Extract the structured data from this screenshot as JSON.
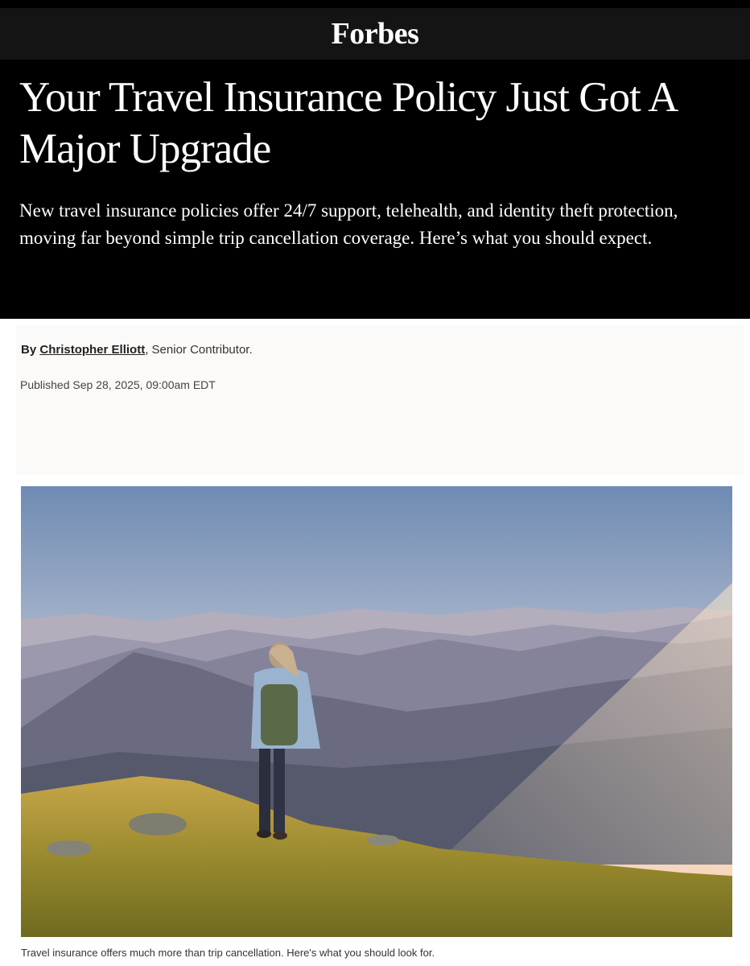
{
  "header": {
    "logo": "Forbes"
  },
  "article": {
    "headline": "Your Travel Insurance Policy Just Got A Major Upgrade",
    "dek": "New travel insurance policies offer 24/7 support, telehealth, and identity theft protection, moving far beyond simple trip cancellation coverage. Here’s what you should expect.",
    "byline_prefix": "By",
    "author": "Christopher Elliott",
    "author_suffix": ",",
    "author_role": "Senior Contributor.",
    "published": "Published Sep 28, 2025, 09:00am EDT",
    "image_caption": "Travel insurance offers much more than trip cancellation. Here's what you should look for."
  },
  "colors": {
    "header_bg": "#141414",
    "hero_bg": "#000000",
    "meta_bg": "#fbfaf9"
  }
}
